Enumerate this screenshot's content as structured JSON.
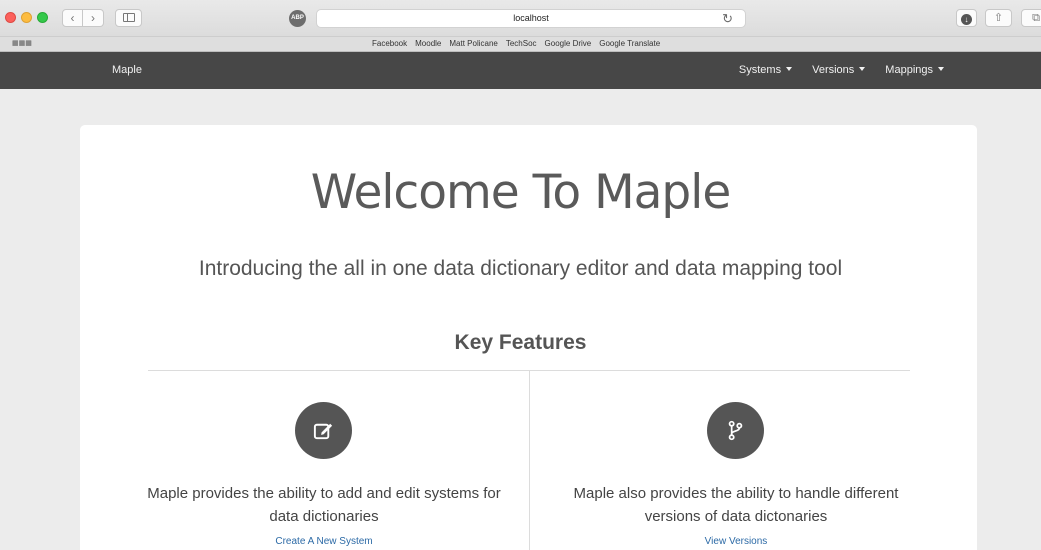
{
  "browser": {
    "url": "localhost",
    "abp_label": "ABP",
    "favorites": [
      "Facebook",
      "Moodle",
      "Matt Policane",
      "TechSoc",
      "Google Drive",
      "Google Translate"
    ]
  },
  "navbar": {
    "brand": "Maple",
    "menus": [
      "Systems",
      "Versions",
      "Mappings"
    ]
  },
  "hero": {
    "title": "Welcome To Maple",
    "tagline": "Introducing the all in one data dictionary editor and data mapping tool",
    "features_heading": "Key Features"
  },
  "features": [
    {
      "icon": "edit-icon",
      "description": "Maple provides the ability to add and edit systems for data dictionaries",
      "link": "Create A New System"
    },
    {
      "icon": "branch-icon",
      "description": "Maple also provides the ability to handle different versions of data dictonaries",
      "link": "View Versions"
    }
  ],
  "colors": {
    "navbar": "#474747",
    "link": "#2c6aa6",
    "icon_circle": "#555555"
  }
}
